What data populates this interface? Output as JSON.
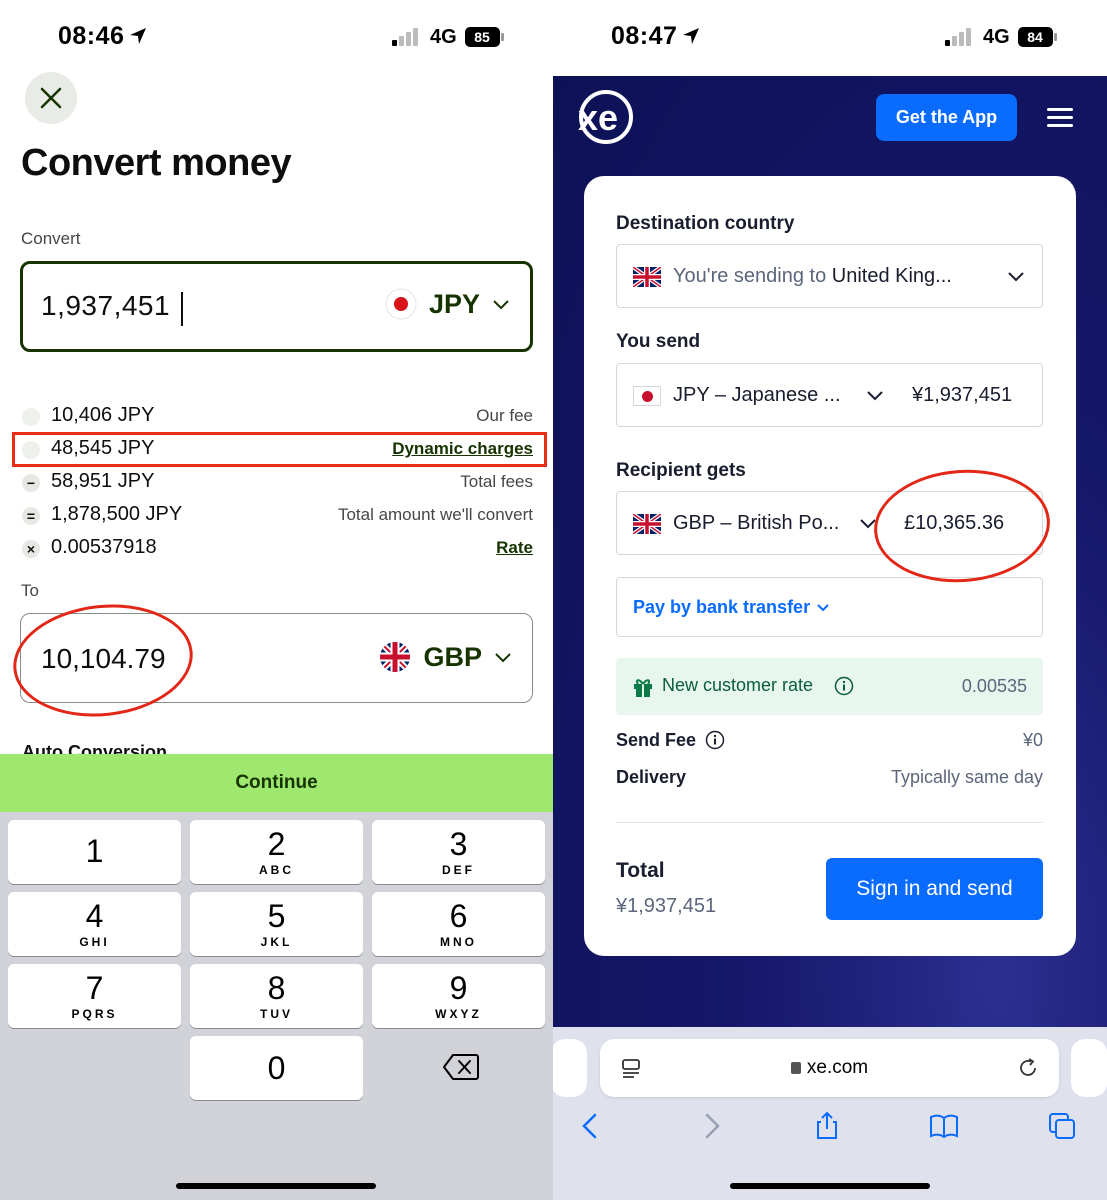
{
  "left": {
    "status": {
      "time": "08:46",
      "network": "4G",
      "battery": "85"
    },
    "title": "Convert money",
    "convert_label": "Convert",
    "convert_amount": "1,937,451",
    "convert_currency": "JPY",
    "fees": [
      {
        "symbol": "",
        "value": "10,406 JPY",
        "desc": "Our fee"
      },
      {
        "symbol": "",
        "value": "48,545 JPY",
        "desc": "Dynamic charges"
      },
      {
        "symbol": "−",
        "value": "58,951 JPY",
        "desc": "Total fees"
      },
      {
        "symbol": "=",
        "value": "1,878,500 JPY",
        "desc": "Total amount we'll convert"
      },
      {
        "symbol": "×",
        "value": "0.00537918",
        "desc": "Rate"
      }
    ],
    "to_label": "To",
    "to_amount": "10,104.79",
    "to_currency": "GBP",
    "auto_conversion": "Auto Conversion",
    "continue_label": "Continue",
    "keypad": [
      {
        "num": "1",
        "letters": ""
      },
      {
        "num": "2",
        "letters": "ABC"
      },
      {
        "num": "3",
        "letters": "DEF"
      },
      {
        "num": "4",
        "letters": "GHI"
      },
      {
        "num": "5",
        "letters": "JKL"
      },
      {
        "num": "6",
        "letters": "MNO"
      },
      {
        "num": "7",
        "letters": "PQRS"
      },
      {
        "num": "8",
        "letters": "TUV"
      },
      {
        "num": "9",
        "letters": "WXYZ"
      },
      {
        "num": "0",
        "letters": ""
      }
    ]
  },
  "right": {
    "status": {
      "time": "08:47",
      "network": "4G",
      "battery": "84"
    },
    "logo": "xe",
    "get_app": "Get the App",
    "destination_label": "Destination country",
    "destination_prefix": "You're sending to",
    "destination_value": "United King...",
    "you_send_label": "You send",
    "you_send_currency": "JPY – Japanese ...",
    "you_send_amount": "¥1,937,451",
    "recipient_label": "Recipient gets",
    "recipient_currency": "GBP – British Po...",
    "recipient_amount": "£10,365.36",
    "pay_method": "Pay by bank transfer",
    "new_customer_rate_label": "New customer rate",
    "new_customer_rate": "0.00535",
    "send_fee_label": "Send Fee",
    "send_fee_value": "¥0",
    "delivery_label": "Delivery",
    "delivery_value": "Typically same day",
    "total_label": "Total",
    "total_value": "¥1,937,451",
    "sign_in_label": "Sign in and send",
    "url": "xe.com"
  },
  "colors": {
    "wise_green": "#9fe870",
    "wise_dark": "#163300",
    "xe_blue": "#0a6cff",
    "xe_navy": "#0d1155",
    "annotation_red": "#e32717"
  }
}
